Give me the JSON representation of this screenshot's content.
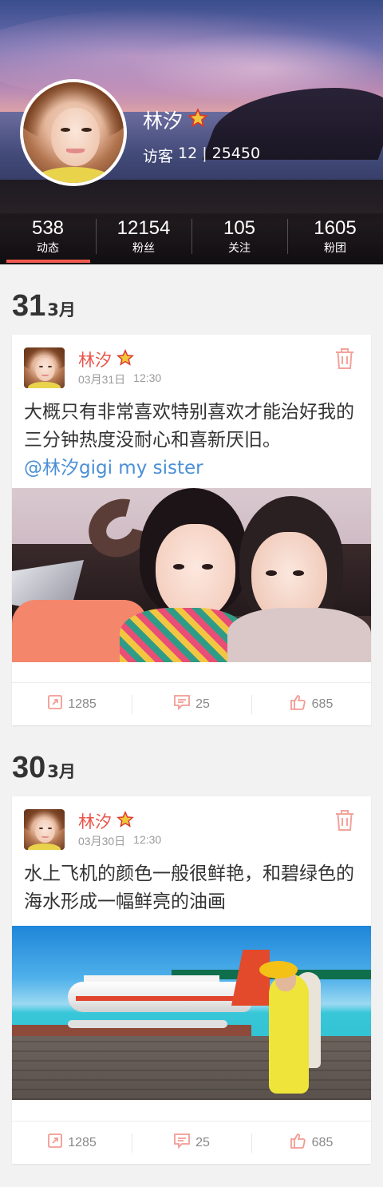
{
  "profile": {
    "name": "林汐",
    "visitor_label": "访客",
    "visitor_today": "12",
    "separator": "|",
    "visitor_total": "25450"
  },
  "stats": [
    {
      "value": "538",
      "label": "动态"
    },
    {
      "value": "12154",
      "label": "粉丝"
    },
    {
      "value": "105",
      "label": "关注"
    },
    {
      "value": "1605",
      "label": "粉团"
    }
  ],
  "posts": [
    {
      "date_day": "31",
      "date_month": "3月",
      "author": "林汐",
      "date": "03月31日",
      "time": "12:30",
      "text": "大概只有非常喜欢特别喜欢才能治好我的三分钟热度没耐心和喜新厌旧。",
      "mention": "@林汐gigi my sister",
      "shares": "1285",
      "comments": "25",
      "likes": "685"
    },
    {
      "date_day": "30",
      "date_month": "3月",
      "author": "林汐",
      "date": "03月30日",
      "time": "12:30",
      "text": "水上飞机的颜色一般很鲜艳，和碧绿色的海水形成一幅鲜亮的油画",
      "shares": "1285",
      "comments": "25",
      "likes": "685"
    }
  ],
  "colors": {
    "accent": "#e8544a",
    "link": "#4a8fd6",
    "tab_underline": "#f05a4f"
  },
  "icons": [
    "star-icon",
    "delete-icon",
    "share-icon",
    "comment-icon",
    "like-icon"
  ]
}
